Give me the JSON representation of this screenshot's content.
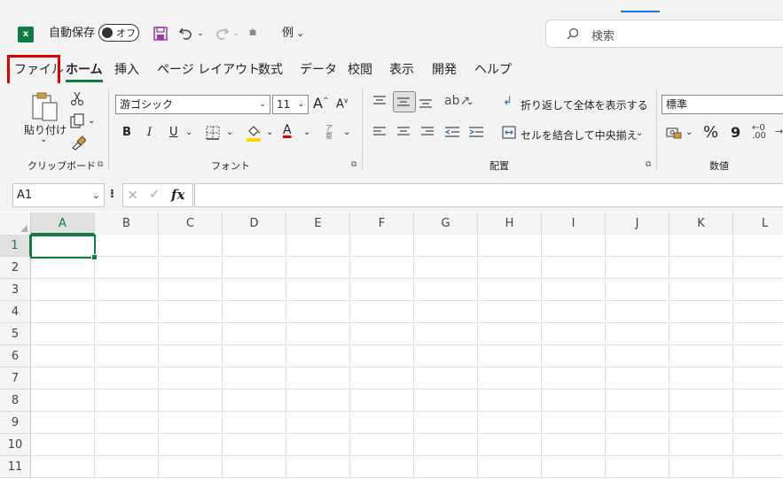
{
  "titlebar": {
    "logo_letter": "x",
    "autosave_label": "自動保存",
    "autosave_state": "オフ",
    "example_label": "例",
    "search_placeholder": "検索"
  },
  "tabs": [
    {
      "label": "ファイル"
    },
    {
      "label": "ホーム"
    },
    {
      "label": "挿入"
    },
    {
      "label": "ページ レイアウト"
    },
    {
      "label": "数式"
    },
    {
      "label": "データ"
    },
    {
      "label": "校閲"
    },
    {
      "label": "表示"
    },
    {
      "label": "開発"
    },
    {
      "label": "ヘルプ"
    }
  ],
  "ribbon": {
    "clipboard": {
      "paste_label": "貼り付け",
      "group_label": "クリップボード"
    },
    "font": {
      "font_name": "游ゴシック",
      "font_size": "11",
      "bold": "B",
      "italic": "I",
      "underline": "U",
      "group_label": "フォント",
      "font_color_glyph": "A",
      "grow_glyph": "A",
      "shrink_glyph": "A",
      "phonetic_glyph": "ア亜"
    },
    "alignment": {
      "wrap_text": "折り返して全体を表示する",
      "merge_center": "セルを結合して中央揃え",
      "group_label": "配置"
    },
    "number": {
      "format": "標準",
      "percent": "%",
      "comma": "9",
      "group_label": "数値"
    }
  },
  "formula_bar": {
    "name_box": "A1",
    "fx": "fx",
    "cancel": "×",
    "enter": "✓",
    "more": "⁝"
  },
  "grid": {
    "columns": [
      "A",
      "B",
      "C",
      "D",
      "E",
      "F",
      "G",
      "H",
      "I",
      "J",
      "K",
      "L"
    ],
    "rows": [
      "1",
      "2",
      "3",
      "4",
      "5",
      "6",
      "7",
      "8",
      "9",
      "10",
      "11"
    ],
    "active_cell": "A1"
  },
  "colors": {
    "excel_green": "#107c41",
    "highlight_red": "#e00000",
    "font_color_red": "#e00000",
    "fill_yellow": "#ffd800"
  }
}
